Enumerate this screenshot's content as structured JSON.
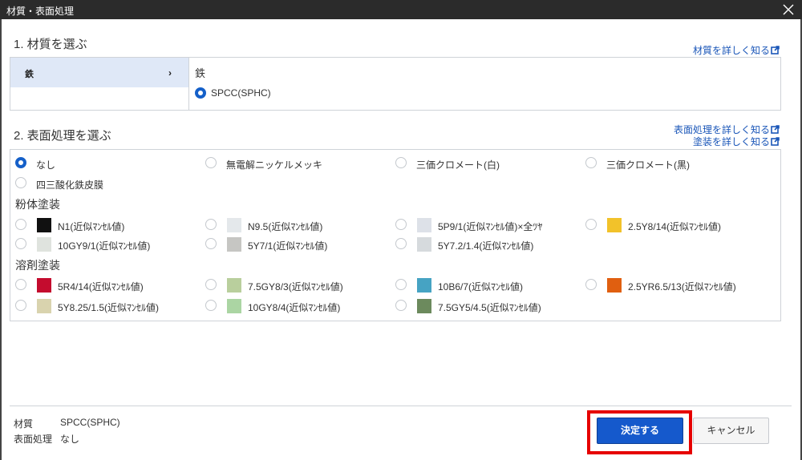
{
  "window": {
    "title": "材質・表面処理"
  },
  "material": {
    "heading": "1. 材質を選ぶ",
    "link": "材質を詳しく知る",
    "category": "鉄",
    "group": "鉄",
    "option": "SPCC(SPHC)"
  },
  "surface": {
    "heading": "2. 表面処理を選ぶ",
    "link_surface": "表面処理を詳しく知る",
    "link_paint": "塗装を詳しく知る",
    "basic": [
      "なし",
      "無電解ニッケルメッキ",
      "三価クロメート(白)",
      "三価クロメート(黒)",
      "四三酸化鉄皮膜"
    ],
    "powder_label": "粉体塗装",
    "powder": [
      {
        "label": "N1(近似ﾏﾝｾﾙ値)",
        "color": "#111111"
      },
      {
        "label": "N9.5(近似ﾏﾝｾﾙ値)",
        "color": "#e4e8eb"
      },
      {
        "label": "5P9/1(近似ﾏﾝｾﾙ値)×全ﾂﾔ",
        "color": "#dde1e8"
      },
      {
        "label": "2.5Y8/14(近似ﾏﾝｾﾙ値)",
        "color": "#f2c22a"
      },
      {
        "label": "10GY9/1(近似ﾏﾝｾﾙ値)",
        "color": "#dfe3de"
      },
      {
        "label": "5Y7/1(近似ﾏﾝｾﾙ値)",
        "color": "#c6c6c3"
      },
      {
        "label": "5Y7.2/1.4(近似ﾏﾝｾﾙ値)",
        "color": "#d6dadd"
      }
    ],
    "solvent_label": "溶剤塗装",
    "solvent": [
      {
        "label": "5R4/14(近似ﾏﾝｾﾙ値)",
        "color": "#c40c2e"
      },
      {
        "label": "7.5GY8/3(近似ﾏﾝｾﾙ値)",
        "color": "#b9cf9d"
      },
      {
        "label": "10B6/7(近似ﾏﾝｾﾙ値)",
        "color": "#46a3c3"
      },
      {
        "label": "2.5YR6.5/13(近似ﾏﾝｾﾙ値)",
        "color": "#e05f10"
      },
      {
        "label": "5Y8.25/1.5(近似ﾏﾝｾﾙ値)",
        "color": "#d9d3ae"
      },
      {
        "label": "10GY8/4(近似ﾏﾝｾﾙ値)",
        "color": "#abd5a3"
      },
      {
        "label": "7.5GY5/4.5(近似ﾏﾝｾﾙ値)",
        "color": "#6c8a5d"
      }
    ]
  },
  "summary": {
    "material_label": "材質",
    "material_value": "SPCC(SPHC)",
    "surface_label": "表面処理",
    "surface_value": "なし"
  },
  "buttons": {
    "confirm": "決定する",
    "cancel": "キャンセル"
  },
  "colors": {
    "accent": "#1559cc",
    "highlight": "#e60000",
    "link": "#1a56b8"
  }
}
